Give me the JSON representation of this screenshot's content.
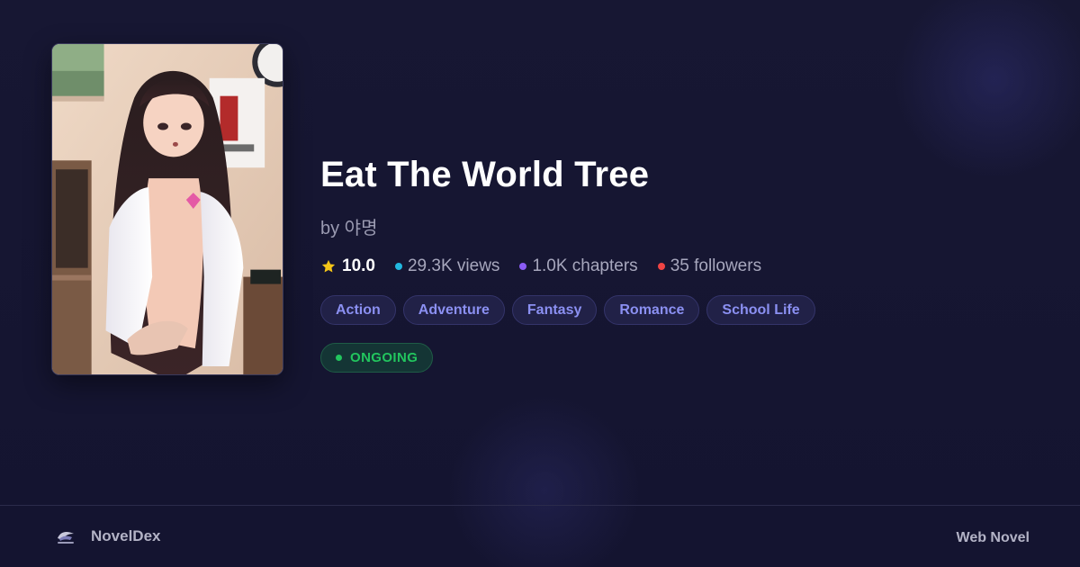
{
  "novel": {
    "title": "Eat The World Tree",
    "author_line": "by 야명"
  },
  "stats": {
    "rating": "10.0",
    "views": "29.3K views",
    "chapters": "1.0K chapters",
    "followers": "35 followers"
  },
  "tags": [
    "Action",
    "Adventure",
    "Fantasy",
    "Romance",
    "School Life"
  ],
  "status": "ONGOING",
  "footer": {
    "brand": "NovelDex",
    "category": "Web Novel"
  },
  "icons": {
    "rating": "star-icon",
    "views": "views-dot-icon",
    "chapters": "chapters-dot-icon",
    "followers": "followers-dot-icon",
    "status": "status-dot-icon",
    "brand": "noveldex-logo-icon"
  },
  "colors": {
    "background": "#161633",
    "star": "#f5c518",
    "views_dot": "#22b8e0",
    "chapters_dot": "#8b5cf6",
    "followers_dot": "#ef4444",
    "tag_text": "#8b90f2",
    "status_green": "#22c55e"
  }
}
